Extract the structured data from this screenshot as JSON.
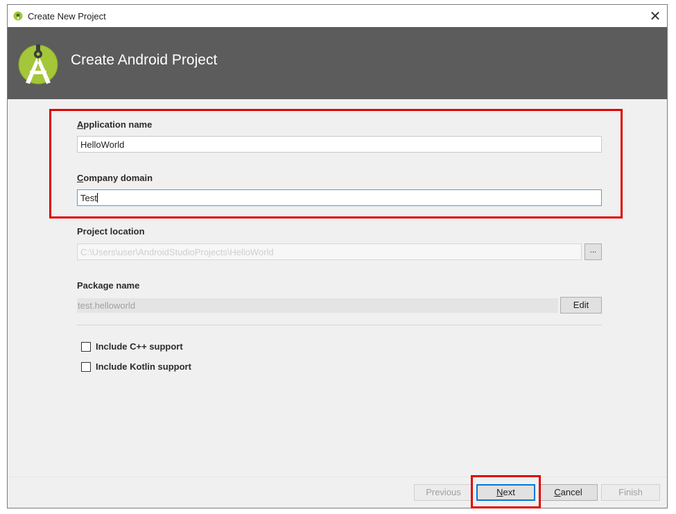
{
  "window": {
    "title": "Create New Project",
    "close_glyph": "✕"
  },
  "header": {
    "title": "Create Android Project",
    "logo_icon": "android-studio-icon"
  },
  "form": {
    "app_name": {
      "label_accel": "A",
      "label_rest": "pplication name",
      "value": "HelloWorld"
    },
    "company_domain": {
      "label_accel": "C",
      "label_rest": "ompany domain",
      "value": "Test"
    },
    "project_location": {
      "label": "Project location",
      "value": "C:\\Users\\user\\AndroidStudioProjects\\HelloWorld",
      "browse_label": "..."
    },
    "package_name": {
      "label": "Package name",
      "value": "test.helloworld",
      "edit_label": "Edit"
    },
    "options": [
      {
        "label": "Include C++ support",
        "checked": false
      },
      {
        "label": "Include Kotlin support",
        "checked": false
      }
    ]
  },
  "buttons": {
    "previous": "Previous",
    "next_accel": "N",
    "next_rest": "ext",
    "cancel_accel": "C",
    "cancel_rest": "ancel",
    "finish": "Finish"
  },
  "colors": {
    "header_bg": "#5c5c5c",
    "android_green": "#a4c639",
    "highlight": "#e00000",
    "focus_blue": "#0078d7"
  }
}
